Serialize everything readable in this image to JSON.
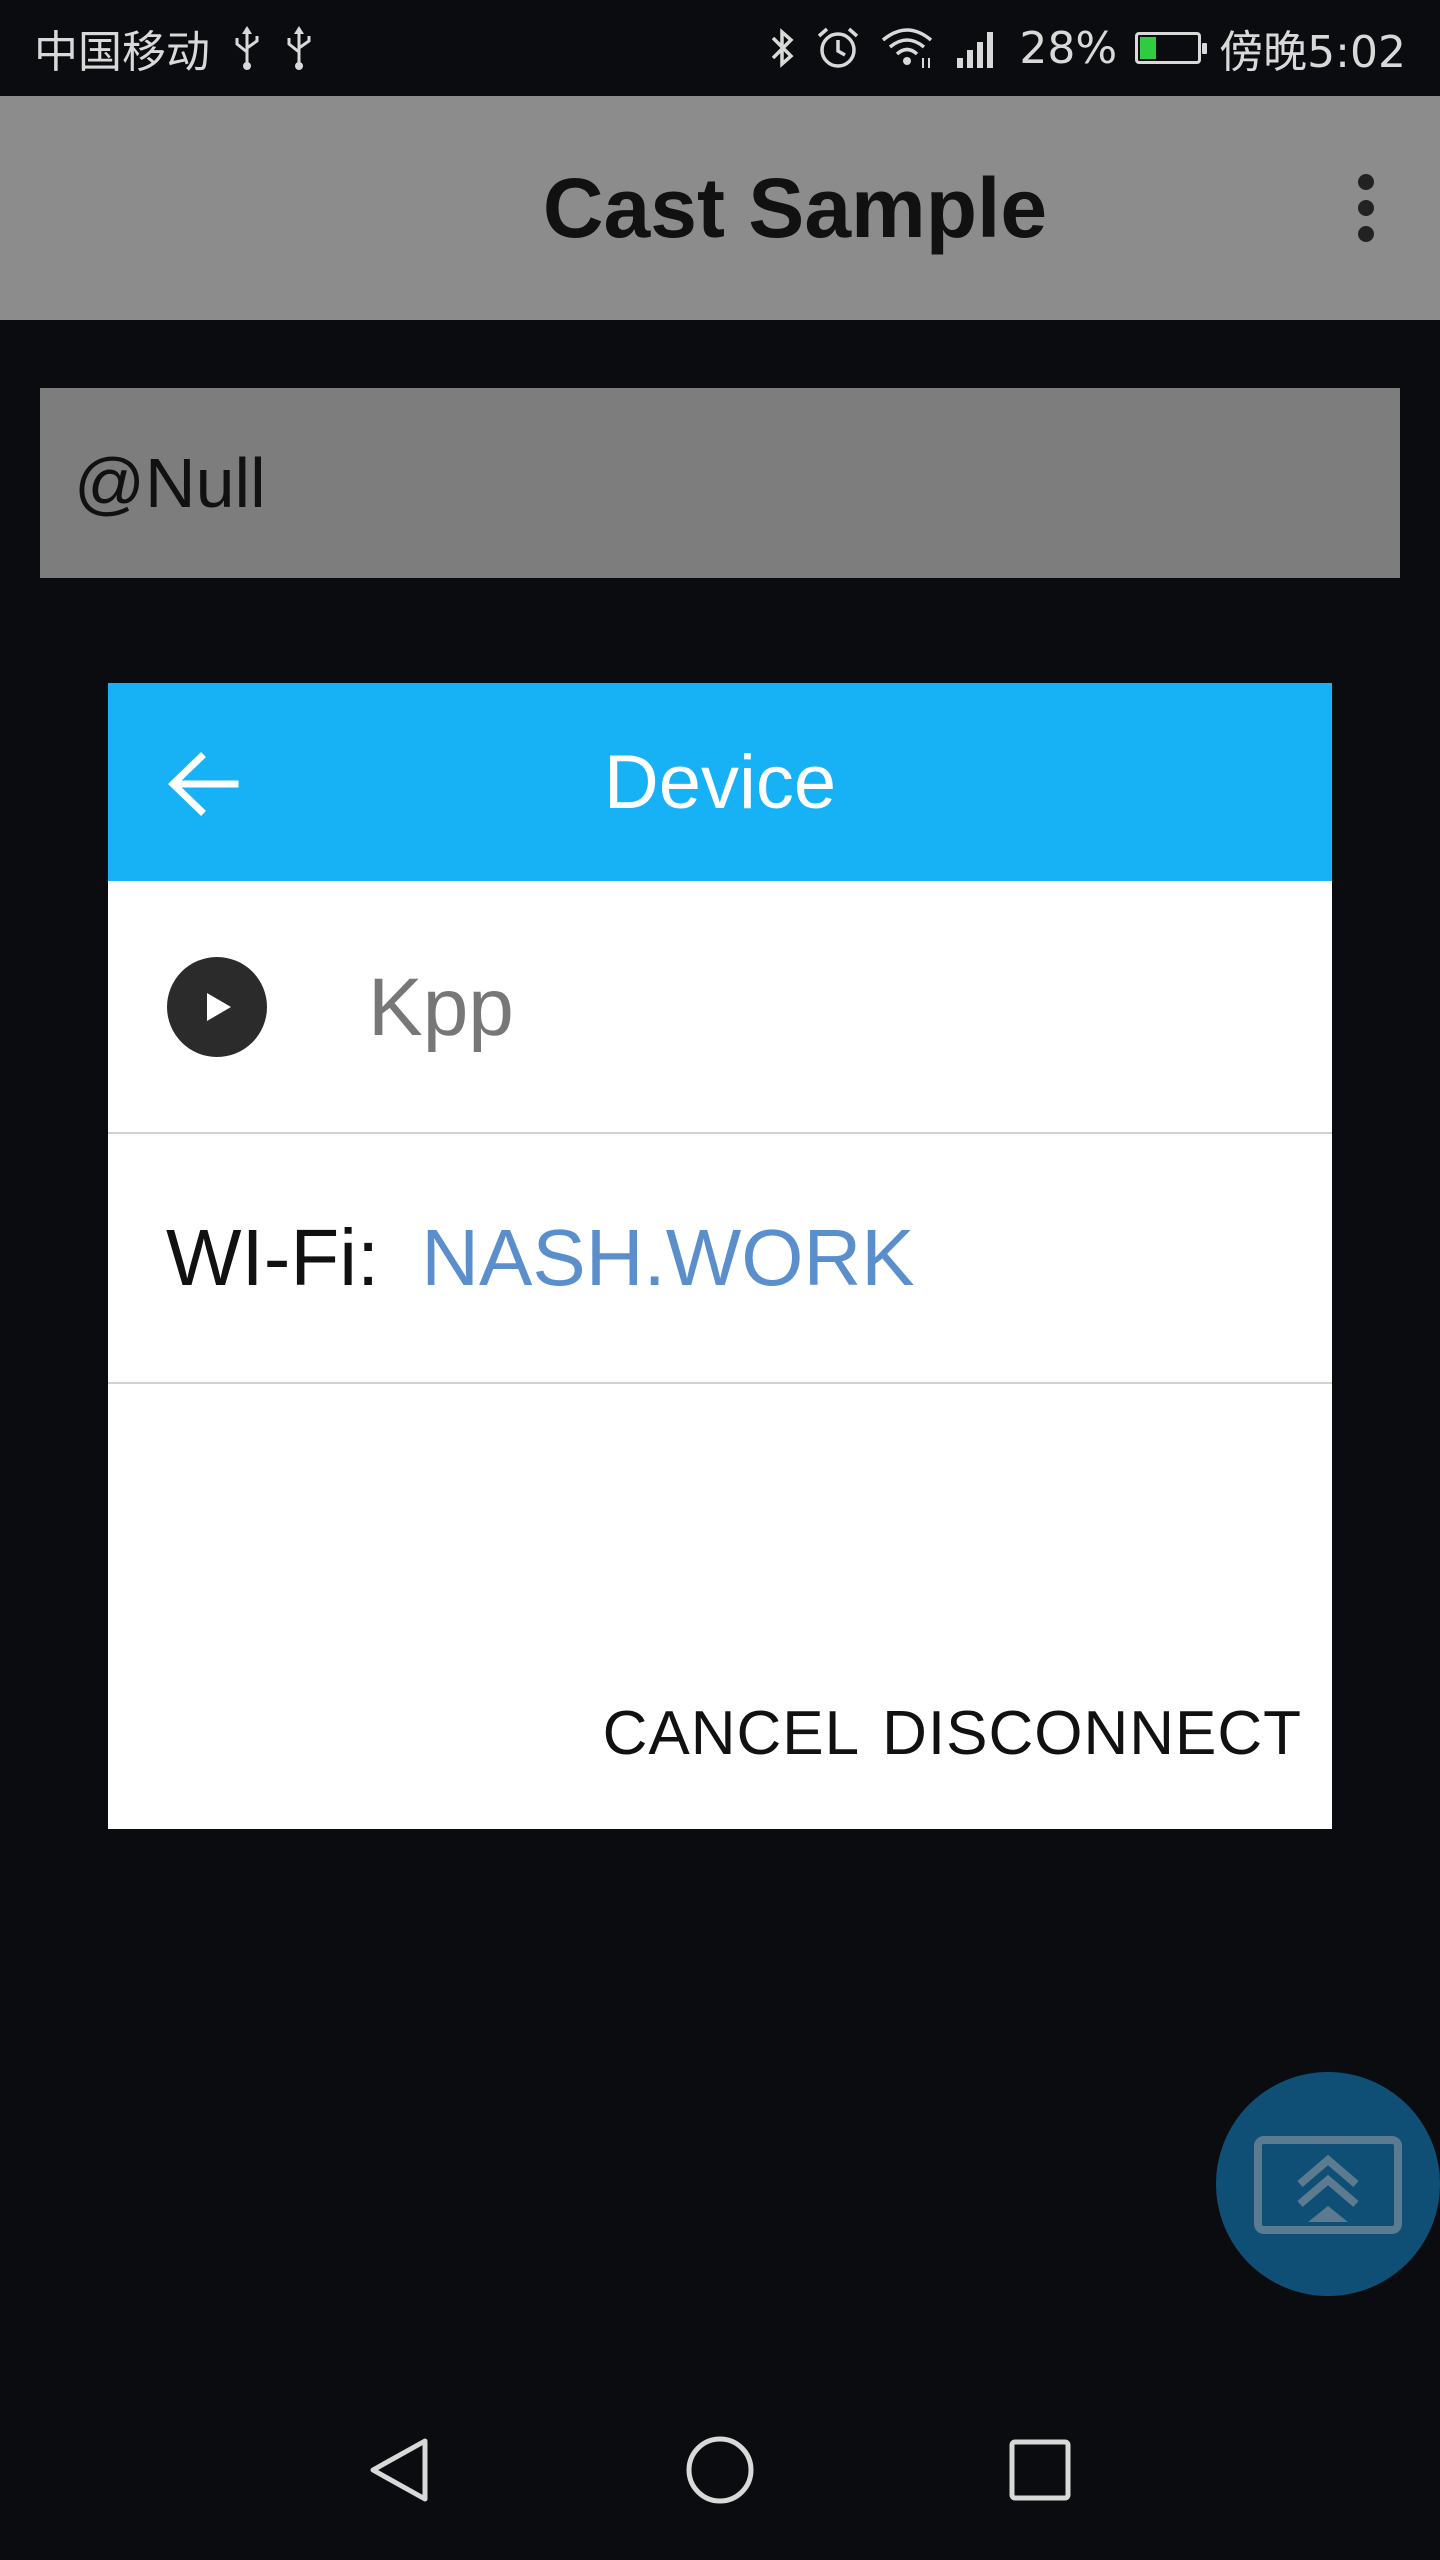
{
  "status_bar": {
    "carrier": "中国移动",
    "battery_percent": "28%",
    "battery_level": 0.28,
    "time": "傍晚5:02",
    "icons": [
      "usb-icon",
      "usb-icon",
      "bluetooth-icon",
      "alarm-icon",
      "wifi-icon",
      "signal-icon",
      "battery-icon"
    ]
  },
  "app_bar": {
    "title": "Cast Sample",
    "menu_icon": "more-vert-icon"
  },
  "input": {
    "value": "@Null"
  },
  "dialog": {
    "title": "Device",
    "back_icon": "arrow-back-icon",
    "device": {
      "icon": "play-circle-icon",
      "name": "Kpp"
    },
    "wifi": {
      "label": "WI-Fi:",
      "value": "NASH.WORK"
    },
    "actions": {
      "cancel": "CANCEL",
      "disconnect": "DISCONNECT"
    }
  },
  "fab": {
    "icon": "cast-screen-icon"
  },
  "nav_bar": {
    "icons": [
      "back-triangle-icon",
      "home-circle-icon",
      "recents-square-icon"
    ]
  },
  "colors": {
    "dialog_header": "#17b1f6",
    "wifi_value": "#5b8fcc",
    "app_bar": "#8c8c8c",
    "background": "#0b0c0f",
    "fab": "#0f4f75"
  }
}
